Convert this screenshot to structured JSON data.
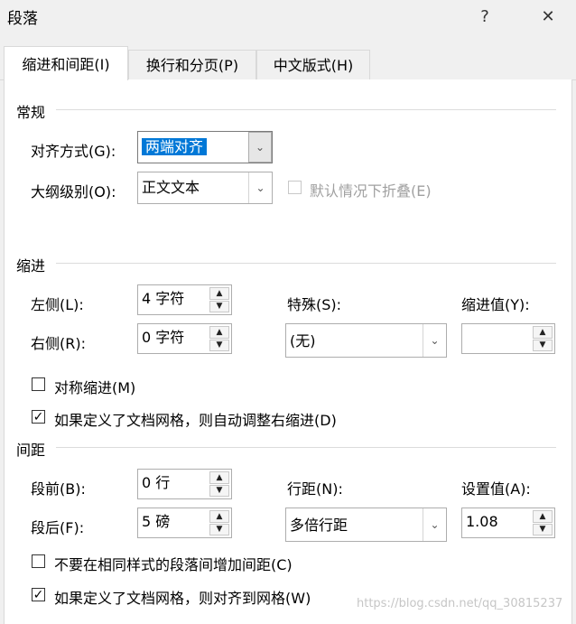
{
  "window": {
    "title": "段落",
    "help": "?",
    "close": "✕"
  },
  "tabs": [
    {
      "label": "缩进和间距(I)"
    },
    {
      "label": "换行和分页(P)"
    },
    {
      "label": "中文版式(H)"
    }
  ],
  "general": {
    "heading": "常规",
    "alignment_label": "对齐方式(G):",
    "alignment_value": "两端对齐",
    "outline_label": "大纲级别(O):",
    "outline_value": "正文文本",
    "collapse_label": "默认情况下折叠(E)"
  },
  "indent": {
    "heading": "缩进",
    "left_label": "左侧(L):",
    "left_value": "4 字符",
    "right_label": "右侧(R):",
    "right_value": "0 字符",
    "special_label": "特殊(S):",
    "special_value": "(无)",
    "by_label": "缩进值(Y):",
    "by_value": "",
    "mirror_label": "对称缩进(M)",
    "auto_adjust_label": "如果定义了文档网格，则自动调整右缩进(D)"
  },
  "spacing": {
    "heading": "间距",
    "before_label": "段前(B):",
    "before_value": "0 行",
    "after_label": "段后(F):",
    "after_value": "5 磅",
    "line_label": "行距(N):",
    "line_value": "多倍行距",
    "at_label": "设置值(A):",
    "at_value": "1.08",
    "no_space_label": "不要在相同样式的段落间增加间距(C)",
    "snap_grid_label": "如果定义了文档网格，则对齐到网格(W)"
  },
  "watermark": "https://blog.csdn.net/qq_30815237"
}
